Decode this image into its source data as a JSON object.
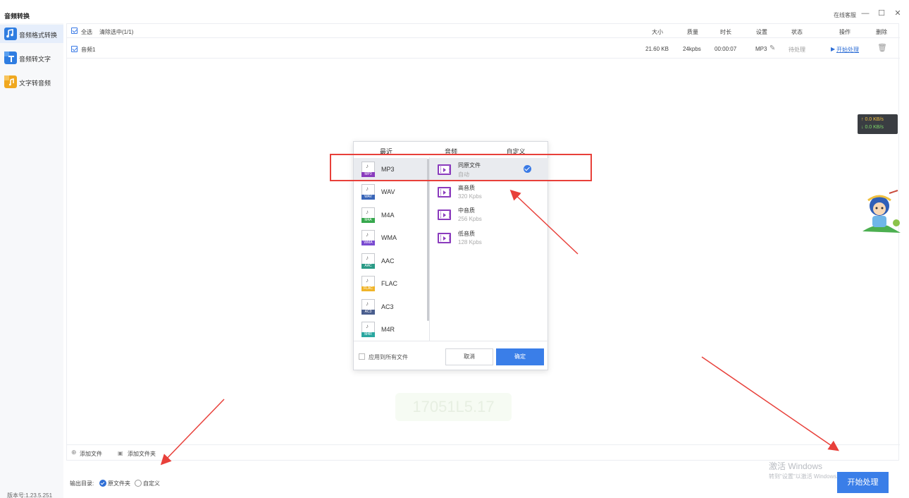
{
  "app": {
    "title": "音频转换",
    "online_service": "在线客服",
    "minimize": "—",
    "maximize": "☐",
    "close": "✕"
  },
  "sidebar": {
    "items": [
      {
        "label": "音频格式转换",
        "icon": "music-convert-icon",
        "color": "#2f7de1",
        "active": true
      },
      {
        "label": "音频转文字",
        "icon": "audio-to-text-icon",
        "color": "#2f7de1",
        "active": false
      },
      {
        "label": "文字转音频",
        "icon": "text-to-audio-icon",
        "color": "#f0a81f",
        "active": false
      }
    ],
    "version": "版本号:1.23.5.251"
  },
  "table": {
    "select_all": "全选",
    "clear_selected": "清除选中(1/1)",
    "headers": {
      "size": "大小",
      "quality": "质量",
      "duration": "时长",
      "settings": "设置",
      "status": "状态",
      "action": "操作",
      "delete": "删除"
    },
    "rows": [
      {
        "name": "音频1",
        "size": "21.60 KB",
        "quality": "24kpbs",
        "duration": "00:00:07",
        "format": "MP3",
        "status": "待处理",
        "action": "开始处理"
      }
    ]
  },
  "bottom_bar": {
    "add_file": "添加文件",
    "add_folder": "添加文件夹"
  },
  "output": {
    "label": "输出目录:",
    "option_source": "原文件夹",
    "option_custom": "自定义"
  },
  "start_button": "开始处理",
  "speed": {
    "up": "↑ 0.0 KB/s",
    "down": "↓ 0.0 KB/s"
  },
  "watermark": {
    "line1": "激活 Windows",
    "line2": "转到\"设置\"以激活 Windows。"
  },
  "faint_text": "17051L5.17",
  "dialog": {
    "tabs": [
      "最近",
      "音频",
      "自定义"
    ],
    "formats": [
      {
        "label": "MP3",
        "badge": "MP3",
        "color": "#8a3bbd"
      },
      {
        "label": "WAV",
        "badge": "WAV",
        "color": "#3a66b8"
      },
      {
        "label": "M4A",
        "badge": "M4A",
        "color": "#36a84d"
      },
      {
        "label": "WMA",
        "badge": "WMA",
        "color": "#7a4bd1"
      },
      {
        "label": "AAC",
        "badge": "AAC",
        "color": "#2a9a86"
      },
      {
        "label": "FLAC",
        "badge": "FLAC",
        "color": "#f0b429"
      },
      {
        "label": "AC3",
        "badge": "AC3",
        "color": "#4a5e8e"
      },
      {
        "label": "M4R",
        "badge": "M4R",
        "color": "#2aa7a0"
      }
    ],
    "qualities": [
      {
        "name": "同原文件",
        "sub": "自动",
        "selected": true
      },
      {
        "name": "高音质",
        "sub": "320 Kpbs",
        "selected": false
      },
      {
        "name": "中音质",
        "sub": "256 Kpbs",
        "selected": false
      },
      {
        "name": "低音质",
        "sub": "128 Kpbs",
        "selected": false
      }
    ],
    "apply_all": "应用到所有文件",
    "cancel": "取消",
    "ok": "确定"
  }
}
